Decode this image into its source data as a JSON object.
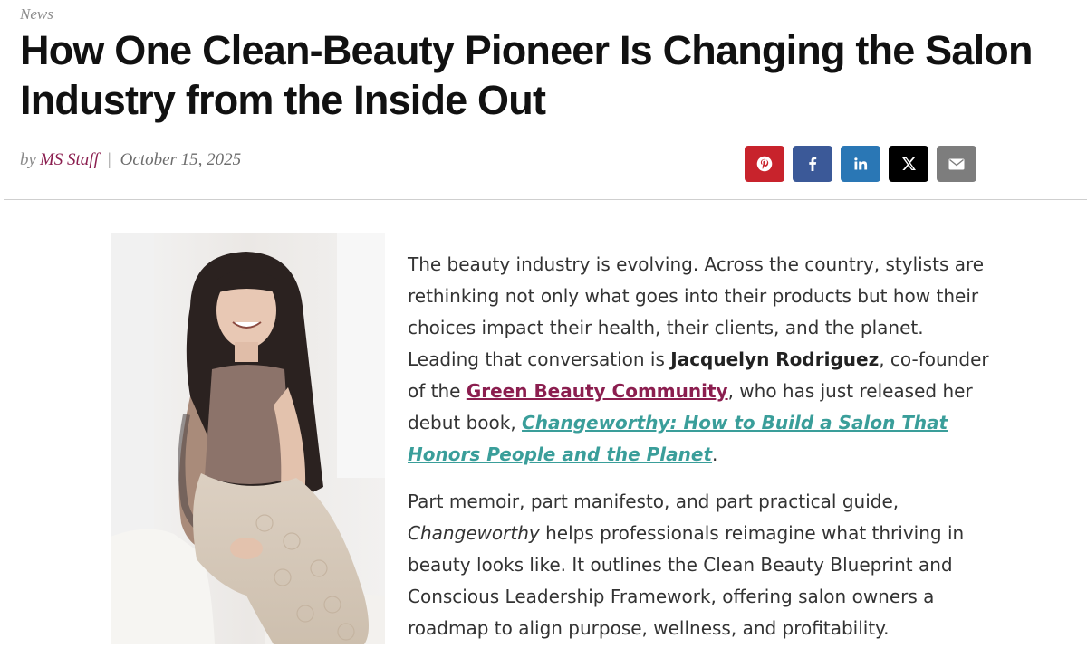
{
  "article": {
    "category": "News",
    "title": "How One Clean-Beauty Pioneer Is Changing the Salon Industry from the Inside Out",
    "byline": {
      "by": "by",
      "author": "MS Staff",
      "separator": "|",
      "date": "October 15, 2025"
    },
    "share": {
      "pinterest": {
        "icon": "pinterest-icon",
        "glyph": "℗"
      },
      "facebook": {
        "icon": "facebook-icon",
        "glyph": "f"
      },
      "linkedin": {
        "icon": "linkedin-icon",
        "glyph": "in"
      },
      "x": {
        "icon": "x-icon",
        "glyph": "𝕏"
      },
      "email": {
        "icon": "email-icon",
        "glyph": "✉"
      }
    },
    "body": {
      "p1": {
        "t1": "The beauty industry is evolving. Across the country, stylists are rethinking not only what goes into their products but how their choices impact their health, their clients, and the planet. Leading that conversation is ",
        "name": "Jacquelyn Rodriguez",
        "t2": ", co-founder of the ",
        "link_community": "Green Beauty Community",
        "t3": ", who has just released her debut book, ",
        "link_book": "Changeworthy: How to Build a Salon That Honors People and the Planet",
        "t4": "."
      },
      "p2": {
        "book_em": "Changeworthy",
        "t1": "Part memoir, part manifesto, and part practical guide, ",
        "t2": " helps professionals reimagine what thriving in beauty looks like. It outlines the Clean Beauty Blueprint and Conscious Leadership Framework, offering salon owners a roadmap to align purpose, wellness, and profitability."
      }
    }
  },
  "colors": {
    "author": "#8b1e4f",
    "link_community": "#8b1e4f",
    "link_book": "#3a9e9a",
    "pinterest": "#c8232c",
    "facebook": "#3b5998",
    "linkedin": "#2a77b5",
    "x": "#000000",
    "email": "#7d7d7d"
  }
}
